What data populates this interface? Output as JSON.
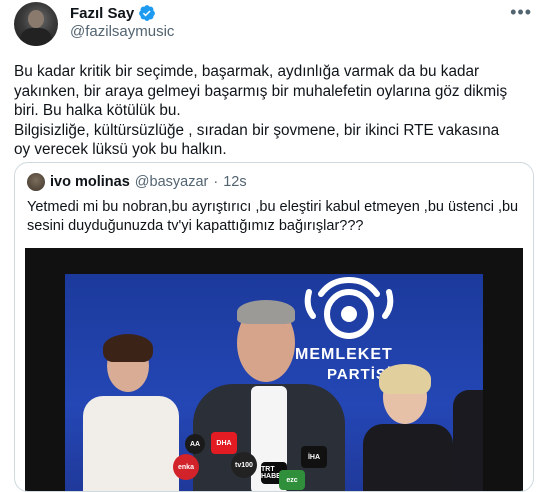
{
  "author": {
    "name": "Fazıl Say",
    "handle": "@fazilsaymusic",
    "verified": true,
    "more_icon": "more-horizontal-icon"
  },
  "tweet": {
    "text": "Bu kadar kritik bir seçimde, başarmak, aydınlığa varmak da bu kadar\nyakınken, bir araya gelmeyi başarmış bir muhalefetin oylarına göz dikmiş\nbiri. Bu halka kötülük bu.\nBilgisizliğe, kültürsüzlüğe , sıradan bir şovmene, bir ikinci RTE vakasına\noy verecek lüksü yok bu halkın."
  },
  "quoted": {
    "name": "ivo molinas",
    "handle": "@basyazar",
    "separator": "·",
    "time": "12s",
    "text": "Yetmedi mi bu nobran,bu ayrıştırıcı ,bu eleştiri kabul etmeyen ,bu üstenci ,bu\nsesini duyduğunuzda tv'yi kapattığımız bağırışlar???"
  },
  "media": {
    "logo_line1": "MEMLEKET",
    "logo_line2": "PARTİSİ",
    "mic_labels": [
      "enka",
      "AA",
      "DHA",
      "tv100",
      "TRT HABER",
      "İHA",
      "ezc"
    ]
  },
  "colors": {
    "verified_blue": "#1d9bf0",
    "backdrop_blue": "#2447b5",
    "text_secondary": "#536471"
  }
}
